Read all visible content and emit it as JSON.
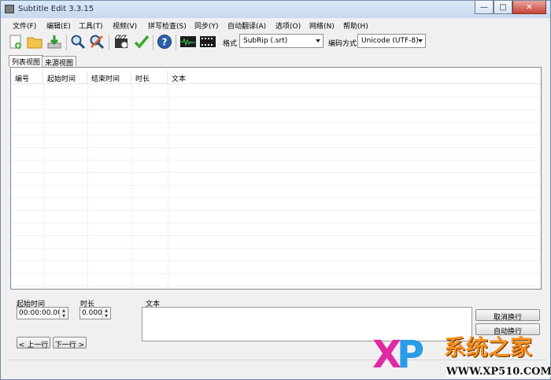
{
  "window": {
    "title": "Subtitle Edit 3.3.15",
    "minimize_icon": "minimize-icon",
    "maximize_icon": "maximize-icon",
    "close_icon": "close-icon"
  },
  "menu": {
    "items": [
      "文件(F)",
      "编辑(E)",
      "工具(T)",
      "视频(V)",
      "拼写检查(S)",
      "同步(Y)",
      "自动翻译(A)",
      "选项(O)",
      "网络(N)",
      "帮助(H)"
    ]
  },
  "toolbar": {
    "icons": [
      "new-file-icon",
      "open-folder-icon",
      "download-icon",
      "find-icon",
      "find-replace-icon",
      "video-clip-icon",
      "check-icon",
      "help-icon",
      "waveform-icon",
      "film-strip-icon"
    ],
    "format_label": "格式",
    "format_value": "SubRip (.srt)",
    "encoding_label": "编码方式",
    "encoding_value": "Unicode (UTF-8)"
  },
  "tabs": [
    "列表视图",
    "来源视图"
  ],
  "list": {
    "columns": [
      "编号",
      "起始时间",
      "结束时间",
      "时长",
      "文本"
    ]
  },
  "editor": {
    "start_time_label": "起始时间",
    "start_time_value": "00:00:00.000",
    "duration_label": "时长",
    "duration_value": "0.000",
    "text_label": "文本",
    "prev_button": "< 上一行",
    "next_button": "下一行 >",
    "unwrap_button": "取消换行",
    "autowrap_button": "自动换行"
  },
  "watermark": {
    "logo": "XP",
    "text": "系统之家",
    "url": "WWW.XP510.COM"
  },
  "colors": {
    "accent": "#2a9be6",
    "watermark_pink": "#e02aa5",
    "watermark_orange": "#f6901c"
  }
}
